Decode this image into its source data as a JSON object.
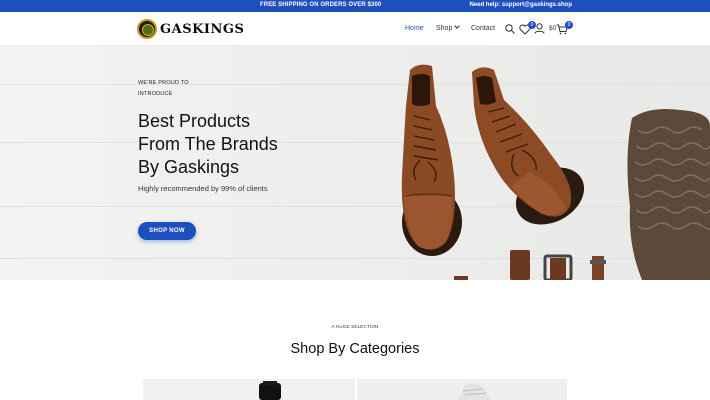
{
  "topbar": {
    "promo": "FREE SHIPPING ON ORDERS OVER $300",
    "help": "Need help: support@gaskings.shop",
    "color": "#1e4fbf"
  },
  "header": {
    "logo_text": "GASKINGS",
    "nav": [
      {
        "label": "Home",
        "active": true
      },
      {
        "label": "Shop",
        "has_dropdown": true
      },
      {
        "label": "Contact"
      }
    ],
    "icons": [
      "search-icon",
      "heart-icon",
      "user-icon",
      "cart-icon"
    ],
    "wishlist_count": "0",
    "cart_total": "$0",
    "cart_count": "0"
  },
  "hero": {
    "eyebrow_line1": "WE'RE PROUD TO",
    "eyebrow_line2": "INTRODUCE",
    "headline": [
      "Best Products",
      "From The Brands",
      "By Gaskings"
    ],
    "subline": "Highly recommended by 99% of clients",
    "cta": "SHOP NOW",
    "accent": "#1e4fbf"
  },
  "categories": {
    "eyebrow": "A HUGE SELECTION",
    "title": "Shop By Categories"
  }
}
